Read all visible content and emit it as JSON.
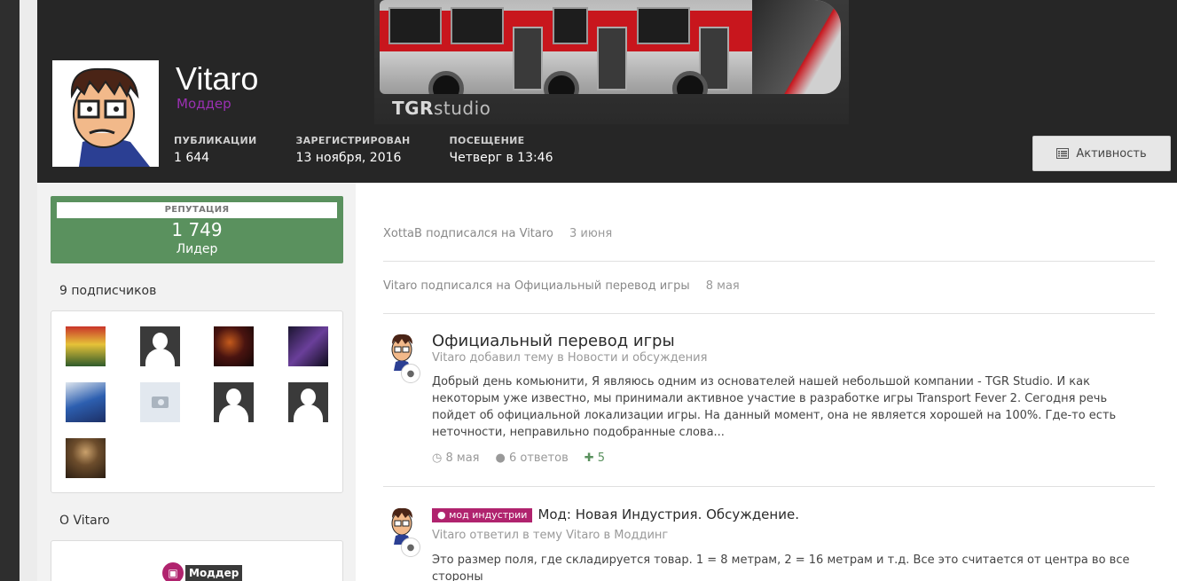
{
  "profile": {
    "username": "Vitaro",
    "group": "Моддер",
    "stats": [
      {
        "label": "ПУБЛИКАЦИИ",
        "value": "1 644"
      },
      {
        "label": "ЗАРЕГИСТРИРОВАН",
        "value": "13 ноября, 2016"
      },
      {
        "label": "ПОСЕЩЕНИЕ",
        "value": "Четверг в 13:46"
      }
    ],
    "activity_button": "Активность"
  },
  "cover": {
    "brand_bold": "TGR",
    "brand_light": "studio"
  },
  "sidebar": {
    "reputation": {
      "label": "РЕПУТАЦИЯ",
      "value": "1 749",
      "title": "Лидер"
    },
    "followers_title": "9 подписчиков",
    "about_title": "О Vitaro",
    "badge_text": "Моддер"
  },
  "feed": {
    "entries": [
      {
        "text": "XottaB подписался на Vitaro",
        "date": "3 июня"
      },
      {
        "text": "Vitaro подписался на Официальный перевод игры",
        "date": "8 мая"
      }
    ],
    "posts": [
      {
        "title": "Официальный перевод игры",
        "subtitle": "Vitaro добавил тему в Новости и обсуждения",
        "body": "Добрый день комьюнити, Я являюсь одним из основателей нашей небольшой компании - TGR Studio. И как некоторым уже известно, мы принимали активное участие в разработке игры Transport Fever 2. Сегодня речь пойдет об официальной локализации игры. На данный момент, она не является хорошей на 100%. Где-то есть неточности, неправильно подобранные слова...",
        "date": "8 мая",
        "replies": "6 ответов",
        "reputation": "5"
      },
      {
        "tag": "мод индустрии",
        "title": "Мод: Новая Индустрия. Обсуждение.",
        "subtitle": "Vitaro ответил в тему Vitaro в Моддинг",
        "body": "Это размер поля, где складируется товар. 1 = 8 метрам, 2 = 16 метрам и т.д. Все это считается от центра во все стороны"
      }
    ]
  },
  "colors": {
    "reputation_green": "#5a915e",
    "group_purple": "#9b30b3",
    "tag_magenta": "#b0236e",
    "header_dark": "#262626"
  }
}
